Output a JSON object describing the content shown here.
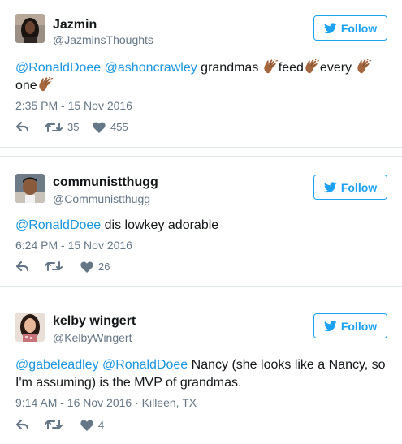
{
  "follow_label": "Follow",
  "tweets": [
    {
      "name": "Jazmin",
      "handle": "@JazminsThoughts",
      "mention1": "@RonaldDoee",
      "mention2": "@ashoncrawley",
      "text_a": " grandmas ",
      "text_b": "feed",
      "text_c": "every",
      "text_d": "one",
      "timestamp": "2:35 PM - 15 Nov 2016",
      "retweets": "35",
      "likes": "455"
    },
    {
      "name": "communistthugg",
      "handle": "@Communistthugg",
      "mention1": "@RonaldDoee",
      "text_a": " dis lowkey adorable",
      "timestamp": "6:24 PM - 15 Nov 2016",
      "retweets": "",
      "likes": "26"
    },
    {
      "name": "kelby wingert",
      "handle": "@KelbyWingert",
      "mention1": "@gabeleadley",
      "mention2": "@RonaldDoee",
      "text_a": " Nancy (she looks like a Nancy, so I'm assuming) is the MVP of grandmas.",
      "timestamp": "9:14 AM - 16 Nov 2016 · Killeen, TX",
      "retweets": "",
      "likes": "4"
    }
  ],
  "colors": {
    "link": "#1b95e0",
    "follow": "#1da1f2",
    "secondary": "#657786"
  },
  "icons": [
    "bird-icon",
    "reply-icon",
    "retweet-icon",
    "heart-icon",
    "clap-emoji"
  ]
}
